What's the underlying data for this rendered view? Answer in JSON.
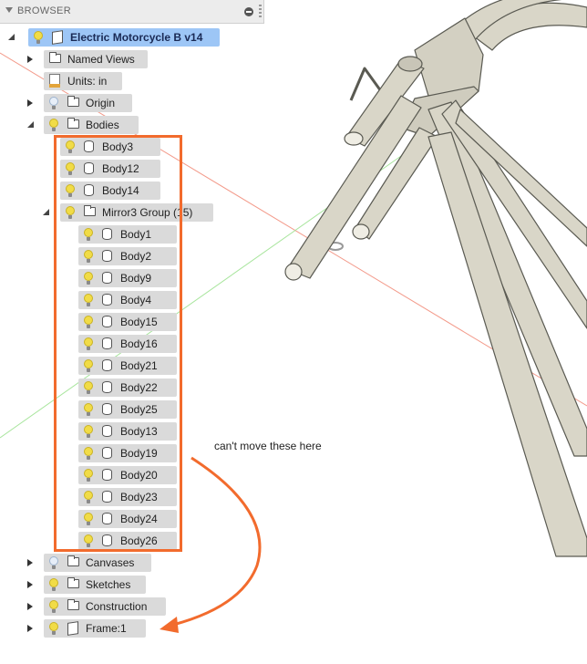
{
  "browser": {
    "title": "BROWSER",
    "root": "Electric Motorcycle B v14",
    "named_views": "Named Views",
    "units": "Units: in",
    "origin": "Origin",
    "bodies": "Bodies",
    "top_bodies": [
      "Body3",
      "Body12",
      "Body14"
    ],
    "mirror_group": "Mirror3 Group (15)",
    "group_bodies": [
      "Body1",
      "Body2",
      "Body9",
      "Body4",
      "Body15",
      "Body16",
      "Body21",
      "Body22",
      "Body25",
      "Body13",
      "Body19",
      "Body20",
      "Body23",
      "Body24",
      "Body26"
    ],
    "canvases": "Canvases",
    "sketches": "Sketches",
    "construction": "Construction",
    "frame": "Frame:1"
  },
  "annotation": {
    "note": "can't move these here",
    "color": "#f26b2d"
  },
  "colors": {
    "selected": "#9dc6f6",
    "row": "#dadada",
    "bulb_on": "#f1dc47",
    "tube": "#d9d6c8"
  }
}
